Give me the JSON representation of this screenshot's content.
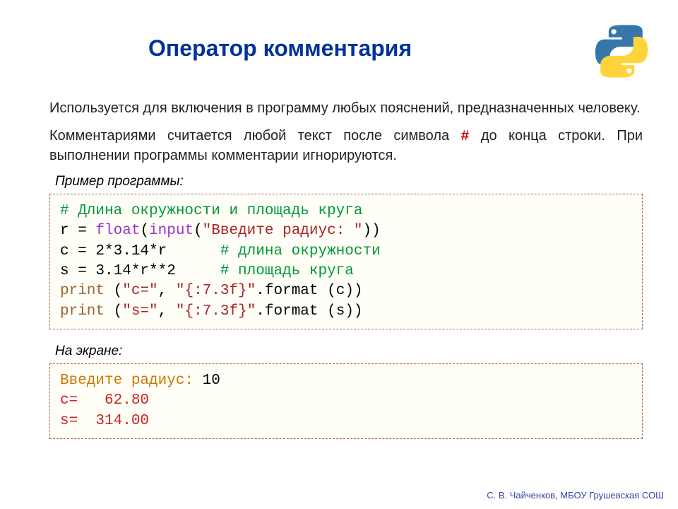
{
  "title": "Оператор комментария",
  "para1": "Используется для включения в программу любых пояснений, предназначенных человеку.",
  "para2a": "Комментариями считается любой текст после символа ",
  "hash": "#",
  "para2b": " до конца строки. При выполнении программы комментарии игнорируются.",
  "label_example": "Пример программы:",
  "code": {
    "l1_comment": "# Длина окружности и площадь круга",
    "l2_a": "r = ",
    "l2_float": "float",
    "l2_b": "(",
    "l2_input": "input",
    "l2_c": "(",
    "l2_str": "\"Введите радиус: \"",
    "l2_d": "))",
    "l3_a": "c = 2*3.14*r      ",
    "l3_comment": "# длина окружности",
    "l4_a": "s = 3.14*r**2     ",
    "l4_comment": "# площадь круга",
    "l5_print": "print",
    "l5_a": " (",
    "l5_s1": "\"c=\"",
    "l5_b": ", ",
    "l5_s2": "\"{:7.3f}\"",
    "l5_c": ".format (c))",
    "l6_print": "print",
    "l6_a": " (",
    "l6_s1": "\"s=\"",
    "l6_b": ", ",
    "l6_s2": "\"{:7.3f}\"",
    "l6_c": ".format (s))"
  },
  "label_screen": "На экране:",
  "output": {
    "l1a": "Введите радиус:",
    "l1b": " 10",
    "l2": "c=   62.80",
    "l3": "s=  314.00"
  },
  "footer": "С. В. Чайченков, МБОУ Грушевская СОШ"
}
